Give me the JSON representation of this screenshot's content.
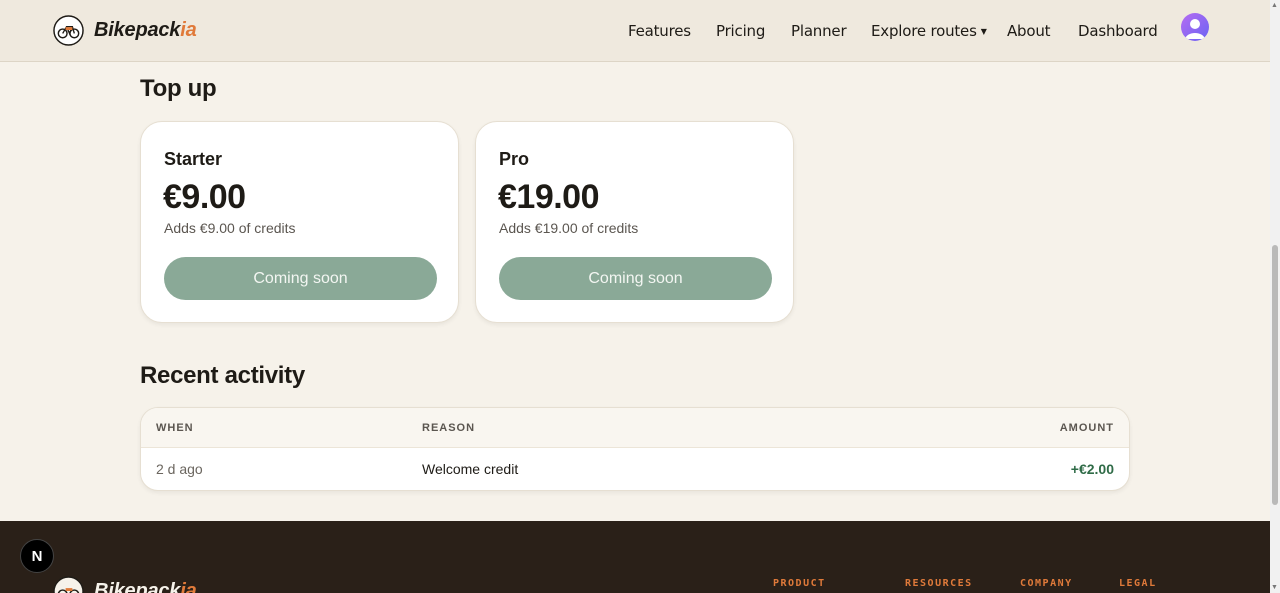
{
  "brand": {
    "name_main": "Bikepack",
    "name_accent": "ia"
  },
  "nav": {
    "features": "Features",
    "pricing": "Pricing",
    "planner": "Planner",
    "explore_routes": "Explore routes",
    "about": "About",
    "dashboard": "Dashboard"
  },
  "topup": {
    "title": "Top up",
    "plans": [
      {
        "name": "Starter",
        "price": "€9.00",
        "desc": "Adds €9.00 of credits",
        "button": "Coming soon"
      },
      {
        "name": "Pro",
        "price": "€19.00",
        "desc": "Adds €19.00 of credits",
        "button": "Coming soon"
      }
    ]
  },
  "activity": {
    "title": "Recent activity",
    "columns": {
      "when": "WHEN",
      "reason": "REASON",
      "amount": "AMOUNT"
    },
    "rows": [
      {
        "when": "2 d ago",
        "reason": "Welcome credit",
        "amount": "+€2.00"
      }
    ]
  },
  "footer": {
    "columns": [
      "PRODUCT",
      "RESOURCES",
      "COMPANY",
      "LEGAL"
    ]
  },
  "dev_badge": "N",
  "colors": {
    "accent": "#e07a3a",
    "button": "#8aa997",
    "positive": "#2f6b47",
    "footer_bg": "#2a2018"
  },
  "icons": {
    "logo": "bike-icon",
    "avatar": "user-avatar-icon",
    "caret": "chevron-down-icon"
  }
}
